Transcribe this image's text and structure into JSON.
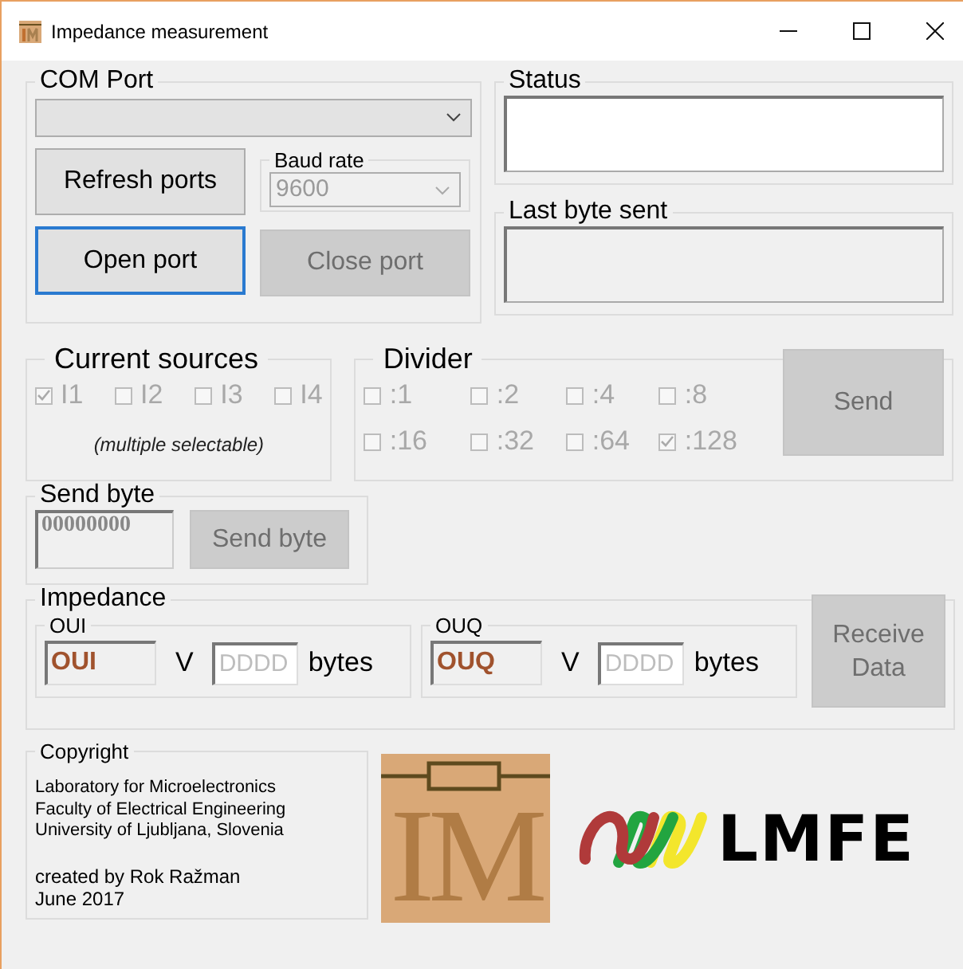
{
  "window": {
    "title": "Impedance measurement"
  },
  "com_port": {
    "title": "COM Port",
    "refresh_button": {
      "label": "Refresh ports",
      "disabled": false
    },
    "baud_rate": {
      "title": "Baud rate",
      "value": "9600",
      "disabled": true
    },
    "open_button": {
      "label": "Open port",
      "focused": true,
      "disabled": false
    },
    "close_button": {
      "label": "Close port",
      "disabled": true
    }
  },
  "status": {
    "title": "Status"
  },
  "last_byte_sent": {
    "title": "Last byte sent"
  },
  "current_sources": {
    "title": "Current sources",
    "items": [
      {
        "label": "I1",
        "checked": true,
        "disabled": true
      },
      {
        "label": "I2",
        "checked": false,
        "disabled": true
      },
      {
        "label": "I3",
        "checked": false,
        "disabled": true
      },
      {
        "label": "I4",
        "checked": false,
        "disabled": true
      }
    ],
    "note": "(multiple selectable)"
  },
  "divider": {
    "title": "Divider",
    "items": [
      {
        "label": ":1",
        "checked": false,
        "disabled": true
      },
      {
        "label": ":2",
        "checked": false,
        "disabled": true
      },
      {
        "label": ":4",
        "checked": false,
        "disabled": true
      },
      {
        "label": ":8",
        "checked": false,
        "disabled": true
      },
      {
        "label": ":16",
        "checked": false,
        "disabled": true
      },
      {
        "label": ":32",
        "checked": false,
        "disabled": true
      },
      {
        "label": ":64",
        "checked": false,
        "disabled": true
      },
      {
        "label": ":128",
        "checked": true,
        "disabled": true
      }
    ],
    "send_button": {
      "label": "Send",
      "disabled": true
    }
  },
  "send_byte": {
    "title": "Send byte",
    "value": "00000000",
    "button": {
      "label": "Send byte",
      "disabled": true
    }
  },
  "impedance": {
    "title": "Impedance",
    "channels": [
      {
        "title": "OUI",
        "value": "OUI",
        "unit": "V",
        "bytes_placeholder": "DDDD",
        "bytes_unit": "bytes"
      },
      {
        "title": "OUQ",
        "value": "OUQ",
        "unit": "V",
        "bytes_placeholder": "DDDD",
        "bytes_unit": "bytes"
      }
    ],
    "receive_button": {
      "label": "Receive Data",
      "disabled": true
    }
  },
  "copyright": {
    "title": "Copyright",
    "lines": [
      "Laboratory for Microelectronics",
      "Faculty of Electrical Engineering",
      "University of Ljubljana, Slovenia"
    ],
    "credits": [
      "created by Rok Ražman",
      "June 2017"
    ]
  },
  "logos": {
    "im": "IM",
    "lmfe": "LMFE"
  }
}
